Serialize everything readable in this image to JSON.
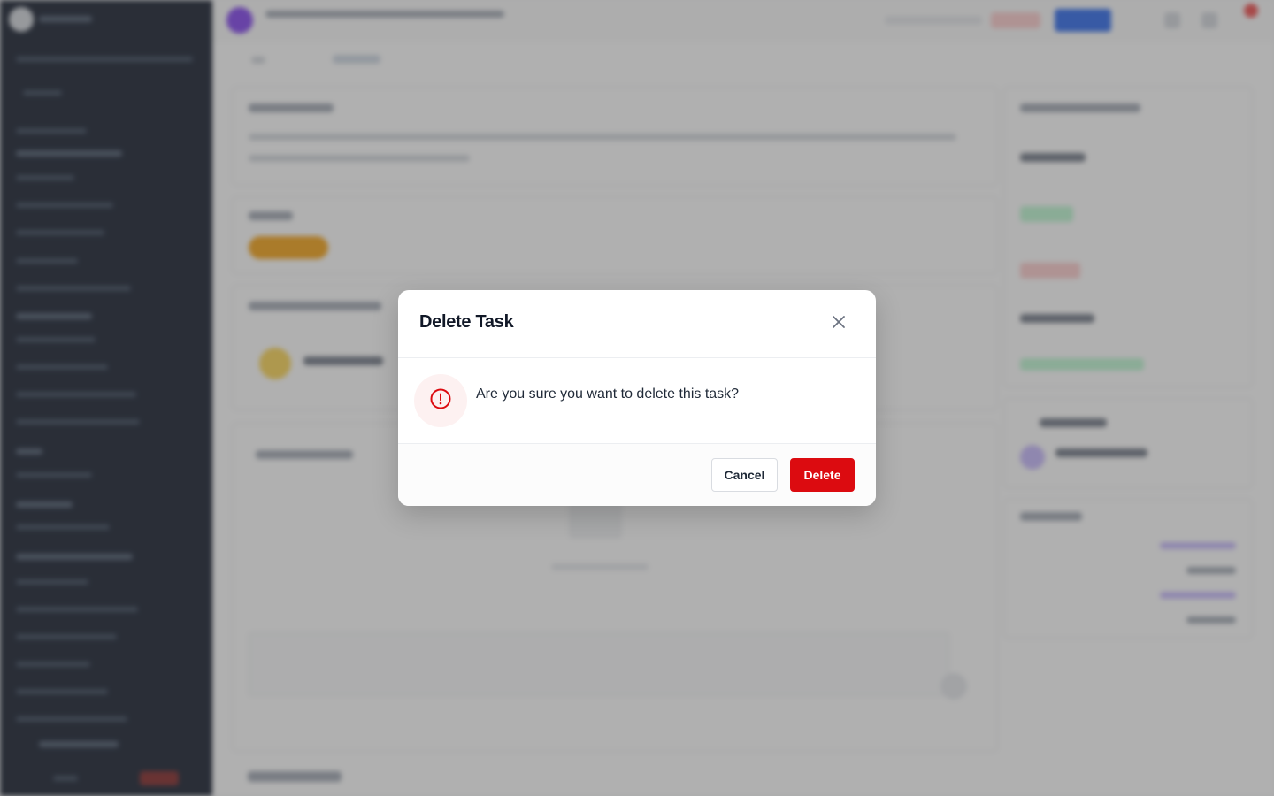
{
  "dialog": {
    "title": "Delete Task",
    "message": "Are you sure you want to delete this task?",
    "cancel_label": "Cancel",
    "delete_label": "Delete",
    "icons": {
      "close": "close-icon",
      "warning": "alert-circle-icon"
    }
  },
  "colors": {
    "danger": "#dc0b10",
    "sidebar": "#0b1324",
    "accent_purple": "#7c3aed",
    "primary_blue": "#2563eb"
  }
}
